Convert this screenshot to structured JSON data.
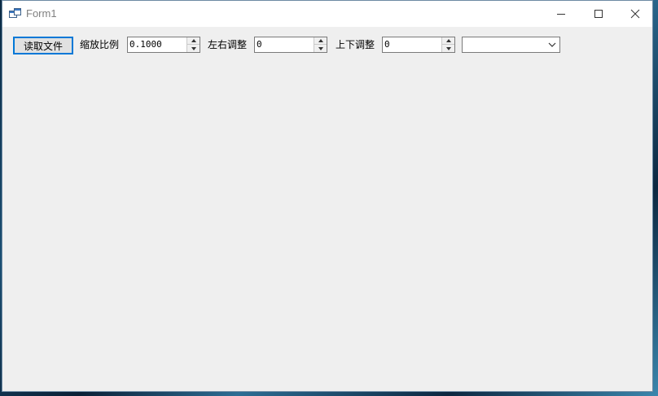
{
  "window": {
    "title": "Form1",
    "caption_icons": [
      "minimize-icon",
      "maximize-icon",
      "close-icon"
    ]
  },
  "toolbar": {
    "read_file_label": "读取文件",
    "scale_label": "缩放比例",
    "scale_value": "0.1000",
    "horizontal_label": "左右调整",
    "horizontal_value": "0",
    "vertical_label": "上下调整",
    "vertical_value": "0",
    "combo_value": ""
  },
  "colors": {
    "focus_border": "#0078d7",
    "client_background": "#efefef"
  }
}
